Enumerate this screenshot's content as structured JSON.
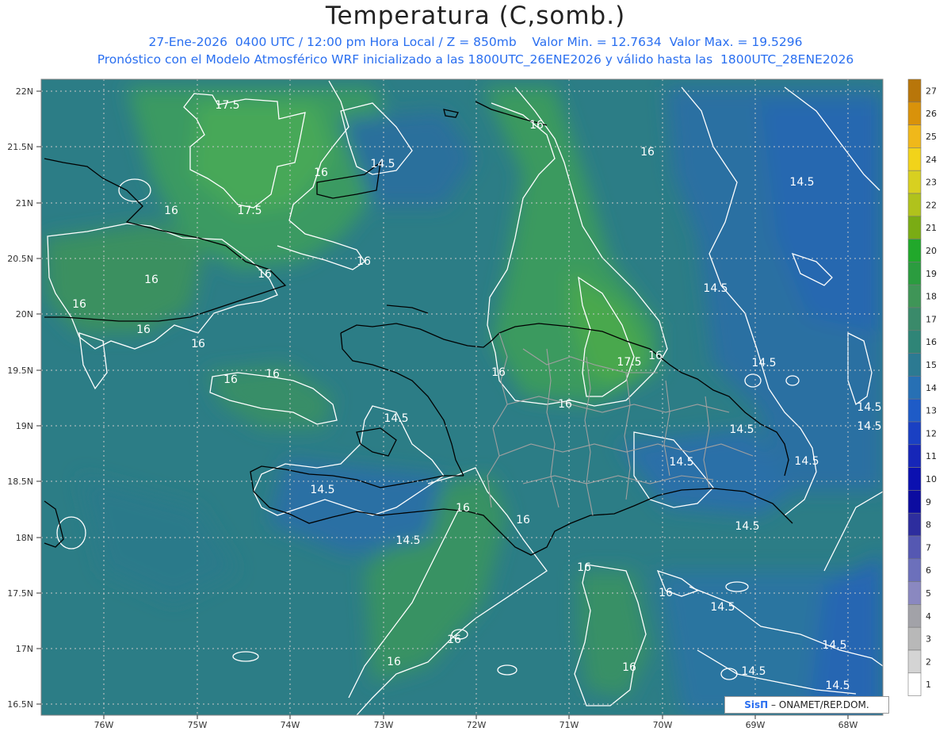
{
  "header": {
    "title": "Temperatura (C,somb.)",
    "line1": "27-Ene-2026  0400 UTC / 12:00 pm Hora Local / Z = 850mb    Valor Min. = 12.7634  Valor Max. = 19.5296",
    "line2": "Pronóstico con el Modelo Atmosférico WRF inicializado a las 1800UTC_26ENE2026 y válido hasta las  1800UTC_28ENE2026"
  },
  "axes": {
    "lat_labels": [
      "22N",
      "21.5N",
      "21N",
      "20.5N",
      "20N",
      "19.5N",
      "19N",
      "18.5N",
      "18N",
      "17.5N",
      "17N",
      "16.5N"
    ],
    "lon_labels": [
      "76W",
      "75W",
      "74W",
      "73W",
      "72W",
      "71W",
      "70W",
      "69W",
      "68W"
    ]
  },
  "legend": {
    "labels": [
      "27",
      "26",
      "25",
      "24",
      "23",
      "22",
      "21",
      "20",
      "19",
      "18",
      "17",
      "16",
      "15",
      "14",
      "13",
      "12",
      "11",
      "10",
      "9",
      "8",
      "7",
      "6",
      "5",
      "4",
      "3",
      "2",
      "1"
    ],
    "colors": [
      "#b8760a",
      "#d9920a",
      "#f0b81a",
      "#f2d31a",
      "#d8d020",
      "#b0c21c",
      "#7aac14",
      "#21a82b",
      "#2b9c3f",
      "#3f9557",
      "#3a8a6a",
      "#2f8577",
      "#2c7a92",
      "#2770b4",
      "#1e5bc7",
      "#1a40c3",
      "#1626b8",
      "#0b10b0",
      "#0c0ca0",
      "#2d2d9e",
      "#5558b2",
      "#6c70bb",
      "#8a88c0",
      "#a2a2a8",
      "#b8b8b8",
      "#d4d4d4",
      "#ffffff"
    ]
  },
  "contour_labels": [
    "17.5",
    "16",
    "14.5"
  ],
  "credit": {
    "brand": "SisΠ",
    "text": " – ONAMET/REP.DOM."
  }
}
